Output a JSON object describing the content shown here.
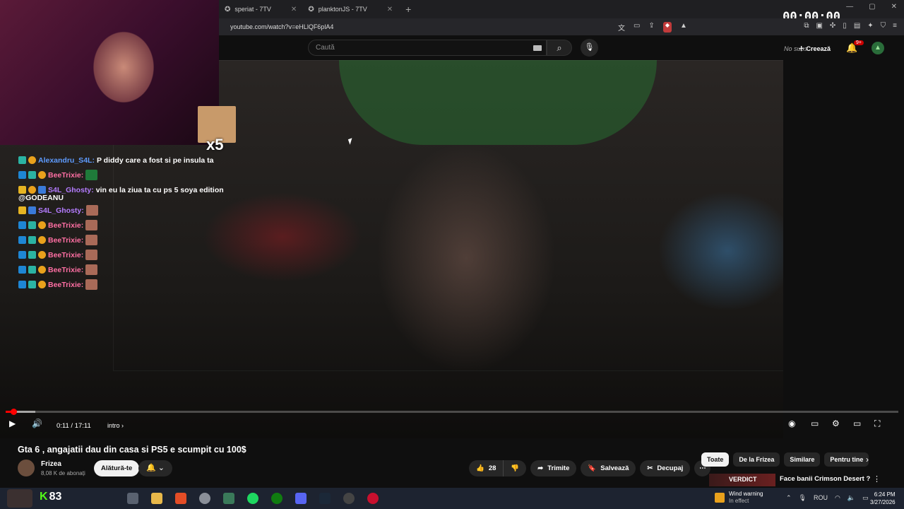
{
  "tabs": [
    {
      "label": "speriat - 7TV"
    },
    {
      "label": "planktonJS - 7TV"
    }
  ],
  "recording_timer": "00:00:00",
  "address_bar": {
    "url": "youtube.com/watch?v=eHLlQF6plA4"
  },
  "youtube_header": {
    "search_placeholder": "Caută",
    "no_sub_text": "No subs",
    "create_label": "Creează",
    "notifications_badge": "9+"
  },
  "stream_overlay": {
    "emote_multiplier": "x5",
    "chat": [
      {
        "user": "Alexandru_S4L:",
        "message": "P diddy care a fost si pe insula ta",
        "color": "blue"
      },
      {
        "user": "BeeTrixie:",
        "message": "",
        "color": "pink",
        "emote": "green"
      },
      {
        "user": "S4L_Ghosty:",
        "message": "vin eu la ziua ta cu ps 5 soya edition",
        "color": "violet"
      },
      {
        "user": "",
        "message": "@GODEANU",
        "color": "none"
      },
      {
        "user": "S4L_Ghosty:",
        "message": "",
        "color": "violet",
        "emote": "face"
      },
      {
        "user": "BeeTrixie:",
        "message": "",
        "color": "pink",
        "emote": "face"
      },
      {
        "user": "BeeTrixie:",
        "message": "",
        "color": "pink",
        "emote": "face"
      },
      {
        "user": "BeeTrixie:",
        "message": "",
        "color": "pink",
        "emote": "face"
      },
      {
        "user": "BeeTrixie:",
        "message": "",
        "color": "pink",
        "emote": "face"
      },
      {
        "user": "BeeTrixie:",
        "message": "",
        "color": "pink",
        "emote": "face"
      }
    ]
  },
  "player": {
    "time_display": "0:11 / 17:11",
    "chapter": "intro",
    "progress_fraction": 0.0107
  },
  "video": {
    "title": "Gta 6 , angajatii dau din casa si PS5 e scumpit cu 100$",
    "channel_name": "Frizea",
    "subscribers": "8,08 K de abonați",
    "join_label": "Alătură-te",
    "like_count": "28",
    "share_label": "Trimite",
    "save_label": "Salvează",
    "clip_label": "Decupaj"
  },
  "filter_chips": [
    {
      "label": "Toate",
      "active": true
    },
    {
      "label": "De la Frizea",
      "active": false
    },
    {
      "label": "Similare",
      "active": false
    },
    {
      "label": "Pentru tine",
      "active": false
    }
  ],
  "recommendation": {
    "thumb_text": "VERDICT",
    "title": "Face banii Crimson Desert ?"
  },
  "taskbar": {
    "kick_count": "83",
    "weather_title": "Wind warning",
    "weather_status": "In effect",
    "language": "ROU",
    "time": "6:24 PM",
    "date": "3/27/2026"
  },
  "colors": {
    "youtube_red": "#ff0000",
    "kick_green": "#53fc18",
    "chat_pink": "#ff6fa3",
    "chat_blue": "#5e9bff",
    "chat_violet": "#b47cff"
  }
}
